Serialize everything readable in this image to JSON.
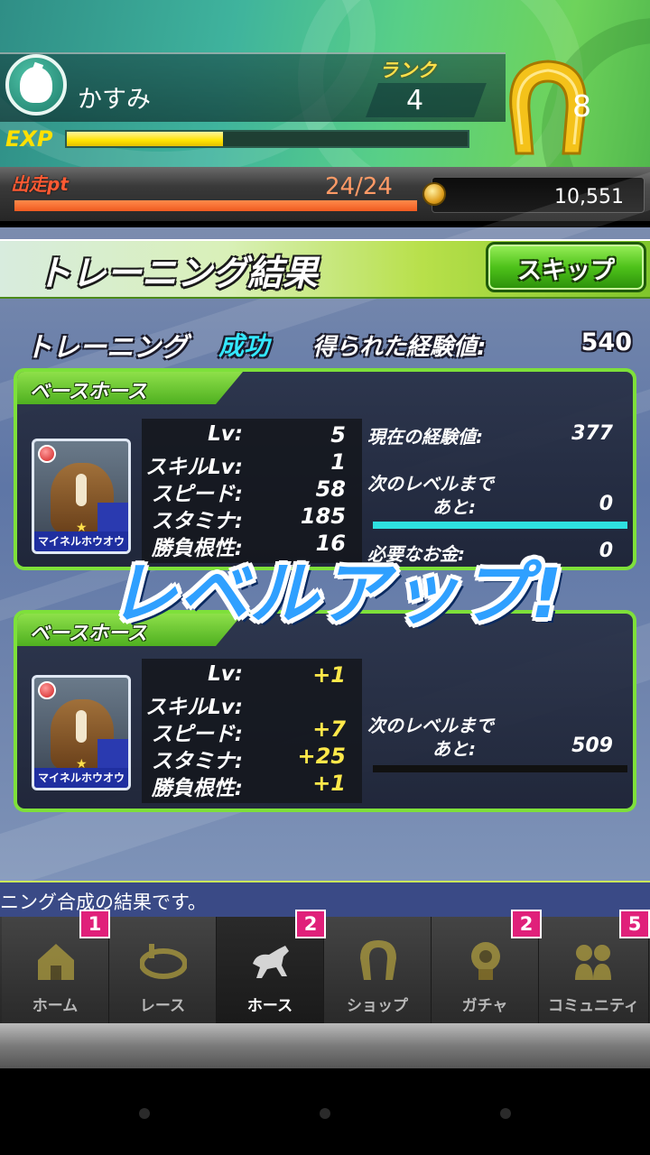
{
  "header": {
    "player_name": "かすみ",
    "rank_label": "ランク",
    "rank_value": "4",
    "exp_label": "EXP",
    "exp_progress": 0.39,
    "horseshoe_count": "8"
  },
  "status": {
    "sortie_label": "出走pt",
    "sortie_value": "24/24",
    "sortie_progress": 1.0,
    "coins": "10,551"
  },
  "title": {
    "text": "トレーニング結果",
    "skip_label": "スキップ"
  },
  "summary": {
    "training_label": "トレーニング",
    "result": "成功",
    "exp_gained_label": "得られた経験値:",
    "exp_gained_value": "540"
  },
  "panel1": {
    "tab_label": "ベースホース",
    "horse_name": "マイネルホウオウ",
    "stats": [
      {
        "label": "Lv:",
        "value": "5"
      },
      {
        "label": "スキルLv:",
        "value": "1"
      },
      {
        "label": "スピード:",
        "value": "58"
      },
      {
        "label": "スタミナ:",
        "value": "185"
      },
      {
        "label": "勝負根性:",
        "value": "16"
      }
    ],
    "current_exp_label": "現在の経験値:",
    "current_exp_value": "377",
    "next_level_label": "次のレベルまで",
    "remaining_label": "あと:",
    "remaining_value": "0",
    "next_level_progress": 1.0,
    "money_label": "必要なお金:",
    "money_value": "0"
  },
  "levelup_text": "レベルアップ!",
  "panel2": {
    "tab_label": "ベースホース",
    "horse_name": "マイネルホウオウ",
    "stats": [
      {
        "label": "Lv:",
        "value": "+1"
      },
      {
        "label": "スキルLv:",
        "value": ""
      },
      {
        "label": "スピード:",
        "value": "+7"
      },
      {
        "label": "スタミナ:",
        "value": "+25"
      },
      {
        "label": "勝負根性:",
        "value": "+1"
      }
    ],
    "next_level_label": "次のレベルまで",
    "remaining_label": "あと:",
    "remaining_value": "509",
    "next_level_progress": 0.0
  },
  "message": "ニング合成の結果です。",
  "nav": [
    {
      "label": "ホーム",
      "badge": "1",
      "icon": "house-icon"
    },
    {
      "label": "レース",
      "badge": "",
      "icon": "race-track-icon"
    },
    {
      "label": "ホース",
      "badge": "2",
      "icon": "horse-icon"
    },
    {
      "label": "ショップ",
      "badge": "",
      "icon": "horseshoe-icon"
    },
    {
      "label": "ガチャ",
      "badge": "2",
      "icon": "gacha-icon"
    },
    {
      "label": "コミュニティ",
      "badge": "5",
      "icon": "community-icon"
    }
  ],
  "colors": {
    "accent_green": "#7ee03a",
    "level_bar": "#2ee0e0",
    "badge_pink": "#e0207a",
    "success_cyan": "#33e8ff",
    "plus_yellow": "#ffe84a"
  }
}
